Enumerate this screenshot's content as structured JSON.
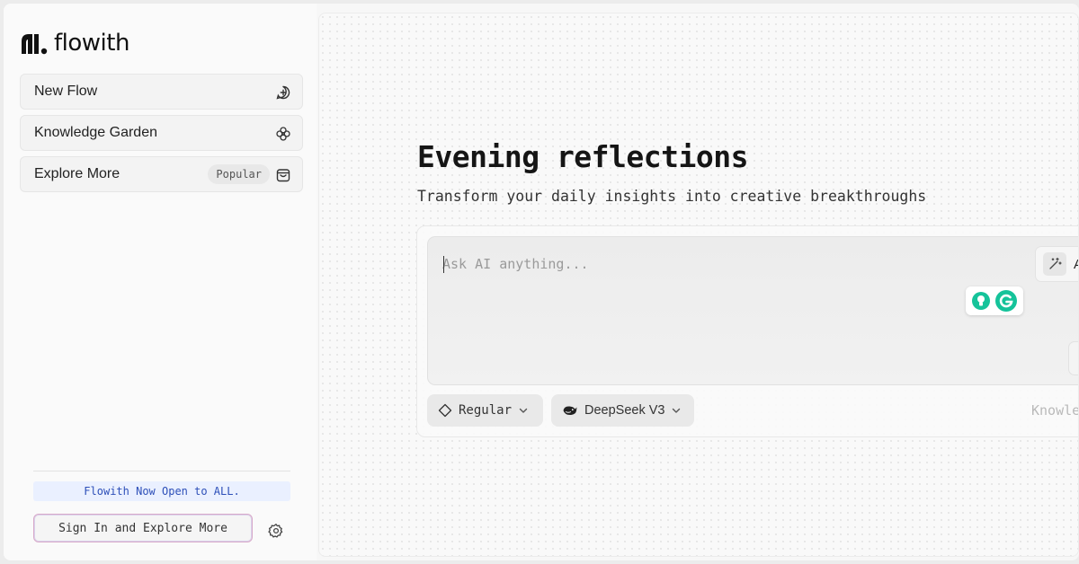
{
  "brand": {
    "name": "flowith"
  },
  "sidebar": {
    "items": [
      {
        "label": "New Flow",
        "icon": "chat-plus-icon"
      },
      {
        "label": "Knowledge Garden",
        "icon": "flower-icon"
      },
      {
        "label": "Explore More",
        "badge": "Popular",
        "icon": "shopping-bag-icon"
      }
    ],
    "announcement": "Flowith Now Open to ALL.",
    "signin_label": "Sign In and Explore More",
    "settings_icon": "gear-icon"
  },
  "main": {
    "headline": "Evening reflections",
    "subheadline": "Transform your daily insights into creative breakthroughs",
    "prompt": {
      "placeholder": "Ask AI anything...",
      "value": ""
    },
    "tool_chip_label": "A",
    "mode_label": "Regular",
    "model_label": "DeepSeek V3",
    "knowledge_label": "Knowle"
  },
  "colors": {
    "accent_link": "#2d4fb8",
    "announcement_bg": "#eaf0ff",
    "grammarly_green": "#15c39a"
  }
}
